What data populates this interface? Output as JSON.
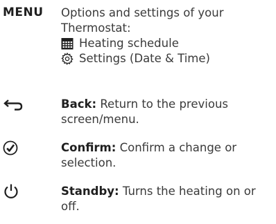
{
  "menu": {
    "key": "MENU",
    "description": "Options and settings of your Thermostat:",
    "items": [
      {
        "icon": "calendar-icon",
        "label": "Heating schedule"
      },
      {
        "icon": "gear-icon",
        "label": "Settings (Date & Time)"
      }
    ]
  },
  "back": {
    "icon": "back-arrow-icon",
    "title": "Back:",
    "text": " Return to the previous screen/menu."
  },
  "confirm": {
    "icon": "checkmark-circle-icon",
    "title": "Confirm:",
    "text": " Confirm a change or selection."
  },
  "standby": {
    "icon": "power-icon",
    "title": "Standby:",
    "text": " Turns the heating on or off."
  }
}
